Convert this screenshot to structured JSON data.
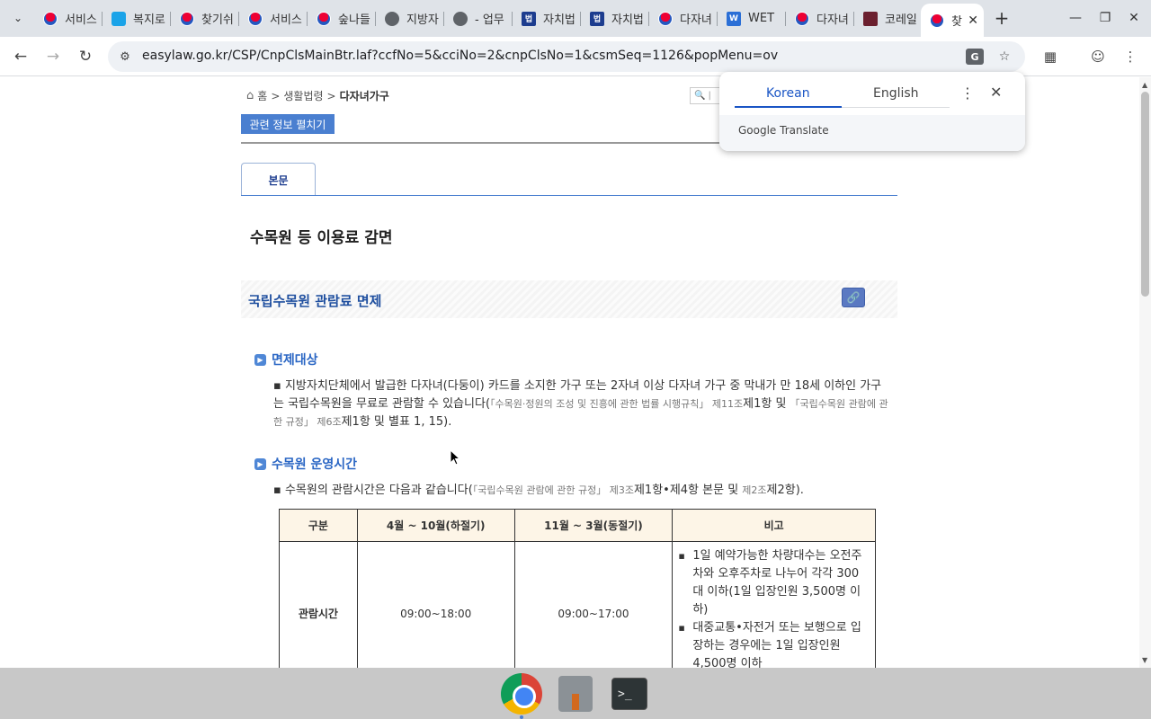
{
  "browser": {
    "tabs": [
      {
        "label": "서비스",
        "favicon": "korea-emblem-icon"
      },
      {
        "label": "복지로",
        "favicon": "bokjiro-icon"
      },
      {
        "label": "찾기쉬",
        "favicon": "korea-emblem-icon"
      },
      {
        "label": "서비스",
        "favicon": "korea-emblem-icon"
      },
      {
        "label": "숲나들",
        "favicon": "korea-emblem-icon"
      },
      {
        "label": "지방자",
        "favicon": "globe-icon"
      },
      {
        "label": "- 업무",
        "favicon": "globe-icon"
      },
      {
        "label": "자치법",
        "favicon": "law-icon"
      },
      {
        "label": "자치법",
        "favicon": "law-icon"
      },
      {
        "label": "다자녀",
        "favicon": "korea-emblem-icon"
      },
      {
        "label": "WET",
        "favicon": "w-icon"
      },
      {
        "label": "다자녀",
        "favicon": "korea-emblem-icon"
      },
      {
        "label": "코레일",
        "favicon": "korail-icon"
      }
    ],
    "active_tab": {
      "label": "찾",
      "favicon": "korea-emblem-icon"
    },
    "url": "easylaw.go.kr/CSP/CnpClsMainBtr.laf?ccfNo=5&cciNo=2&cnpClsNo=1&csmSeq=1126&popMenu=ov"
  },
  "translate_popup": {
    "source_lang": "Korean",
    "target_lang": "English",
    "footer": "Google Translate"
  },
  "page": {
    "breadcrumb": {
      "home": "홈",
      "sep1": ">",
      "level1": "생활법령",
      "sep2": ">",
      "current": "다자녀가구"
    },
    "search_placeholder": "|",
    "related_button": "관련 정보 펼치기",
    "body_tab": "본문",
    "title": "수목원 등 이용료 감면",
    "section_title": "국립수목원 관람료 면제",
    "sub1": "면제대상",
    "para1_main": "지방자치단체에서 발급한 다자녀(다둥이) 카드를 소지한 가구 또는 2자녀 이상 다자녀 가구 중 막내가 만 18세 이하인 가구는 국립수목원을 무료로 관람할 수 있습니다(",
    "para1_law1": "「수목원·정원의 조성 및 진흥에 관한 법률 시행규칙」 제11조",
    "para1_t1": "제1항 및 ",
    "para1_law2": "「국립수목원 관람에 관한 규정」 제6조",
    "para1_t2": "제1항 및 별표 1, 15).",
    "sub2": "수목원 운영시간",
    "para2_main": "수목원의 관람시간은 다음과 같습니다(",
    "para2_law1": "「국립수목원 관람에 관한 규정」 제3조",
    "para2_t1": "제1항•제4항 본문 및 ",
    "para2_law2": "제2조",
    "para2_t2": "제2항).",
    "table": {
      "headers": [
        "구분",
        "4월 ~ 10월(하절기)",
        "11월 ~ 3월(동절기)",
        "비고"
      ],
      "row": {
        "label": "관람시간",
        "summer": "09:00~18:00",
        "winter": "09:00~17:00",
        "notes": [
          "1일 예약가능한 차량대수는 오전주차와 오후주차로 나누어 각각 300대 이하(1일 입장인원 3,500명 이하)",
          "대중교통•자전거 또는 보행으로 입장하는 경우에는 1일 입장인원 4,500명 이하"
        ]
      }
    }
  },
  "taskbar": {
    "apps": [
      "chrome-icon",
      "tool-icon",
      "terminal-icon"
    ],
    "terminal_glyph": ">_"
  }
}
